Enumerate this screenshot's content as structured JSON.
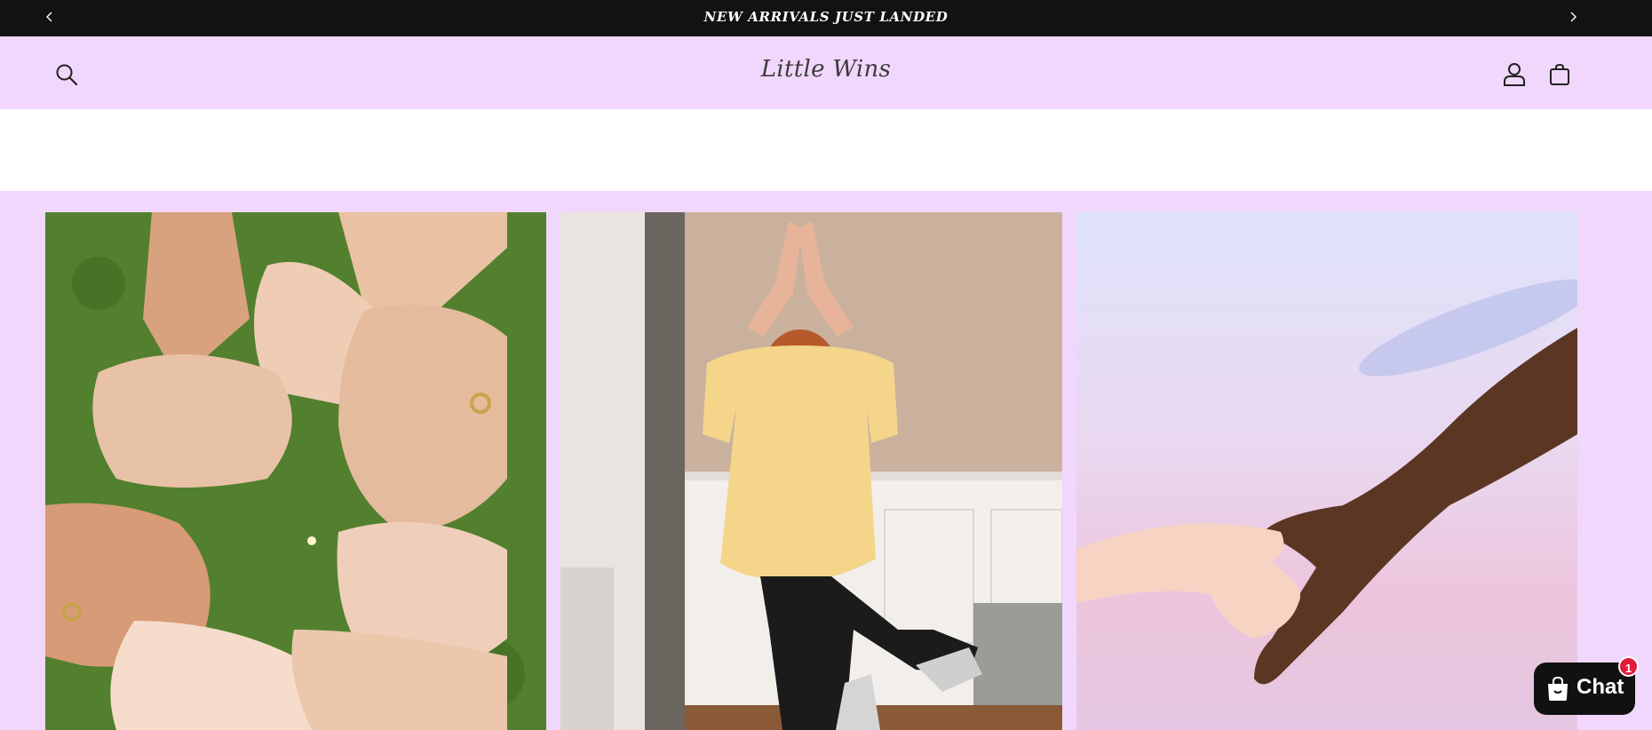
{
  "announcement": {
    "text": "NEW ARRIVALS JUST LANDED"
  },
  "header": {
    "store_name": "Little Wins"
  },
  "gallery": {
    "images": [
      {
        "icon": "hands-circle-photo"
      },
      {
        "icon": "yoga-prosthetic-photo"
      },
      {
        "icon": "holding-hands-sky-photo"
      }
    ]
  },
  "chat": {
    "label": "Chat",
    "badge": "1"
  },
  "colors": {
    "header_bg": "#f1d7fc",
    "announcement_bg": "#121212",
    "chat_bg": "#111111",
    "badge": "#e11c3a"
  }
}
